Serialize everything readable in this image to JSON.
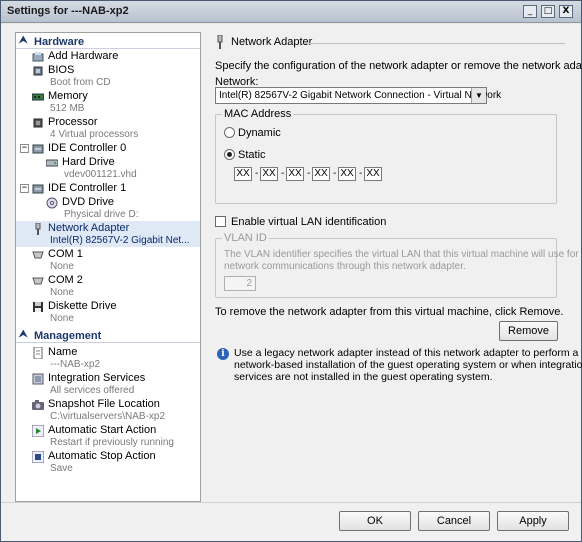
{
  "window": {
    "title": "Settings for ---NAB-xp2",
    "minimize": "_",
    "maximize": "□",
    "close": "X"
  },
  "sidebar": {
    "hardware_header": "Hardware",
    "management_header": "Management",
    "hardware_items": [
      {
        "label": "Add Hardware",
        "sub": ""
      },
      {
        "label": "BIOS",
        "sub": "Boot from CD"
      },
      {
        "label": "Memory",
        "sub": "512 MB"
      },
      {
        "label": "Processor",
        "sub": "4 Virtual processors"
      },
      {
        "label": "IDE Controller 0",
        "sub": ""
      },
      {
        "label": "Hard Drive",
        "sub": "vdev001121.vhd"
      },
      {
        "label": "IDE Controller 1",
        "sub": ""
      },
      {
        "label": "DVD Drive",
        "sub": "Physical drive D:"
      },
      {
        "label": "Network Adapter",
        "sub": "Intel(R) 82567V-2 Gigabit Net..."
      },
      {
        "label": "COM 1",
        "sub": "None"
      },
      {
        "label": "COM 2",
        "sub": "None"
      },
      {
        "label": "Diskette Drive",
        "sub": "None"
      }
    ],
    "management_items": [
      {
        "label": "Name",
        "sub": "---NAB-xp2"
      },
      {
        "label": "Integration Services",
        "sub": "All services offered"
      },
      {
        "label": "Snapshot File Location",
        "sub": "C:\\virtualservers\\NAB-xp2"
      },
      {
        "label": "Automatic Start Action",
        "sub": "Restart if previously running"
      },
      {
        "label": "Automatic Stop Action",
        "sub": "Save"
      }
    ]
  },
  "main": {
    "header": "Network Adapter",
    "description": "Specify the configuration of the network adapter or remove the network adapter.",
    "network_label": "Network:",
    "network_value": "Intel(R) 82567V-2 Gigabit Network Connection - Virtual Network",
    "mac_group": "MAC Address",
    "dynamic_label": "Dynamic",
    "static_label": "Static",
    "mac_octets": [
      "XX",
      "XX",
      "XX",
      "XX",
      "XX",
      "XX"
    ],
    "mac_sep": "-",
    "vlan_check_label": "Enable virtual LAN identification",
    "vlan_group": "VLAN ID",
    "vlan_desc_1": "The VLAN identifier specifies the virtual LAN that this virtual machine will use for all",
    "vlan_desc_2": "network communications through this network adapter.",
    "vlan_value": "2",
    "remove_text": "To remove the network adapter from this virtual machine, click Remove.",
    "remove_button": "Remove",
    "info_1": "Use a legacy network adapter instead of this network adapter to perform a",
    "info_2": "network-based installation of the guest operating system or when integration",
    "info_3": "services are not installed in the guest operating system."
  },
  "footer": {
    "ok": "OK",
    "cancel": "Cancel",
    "apply": "Apply"
  }
}
